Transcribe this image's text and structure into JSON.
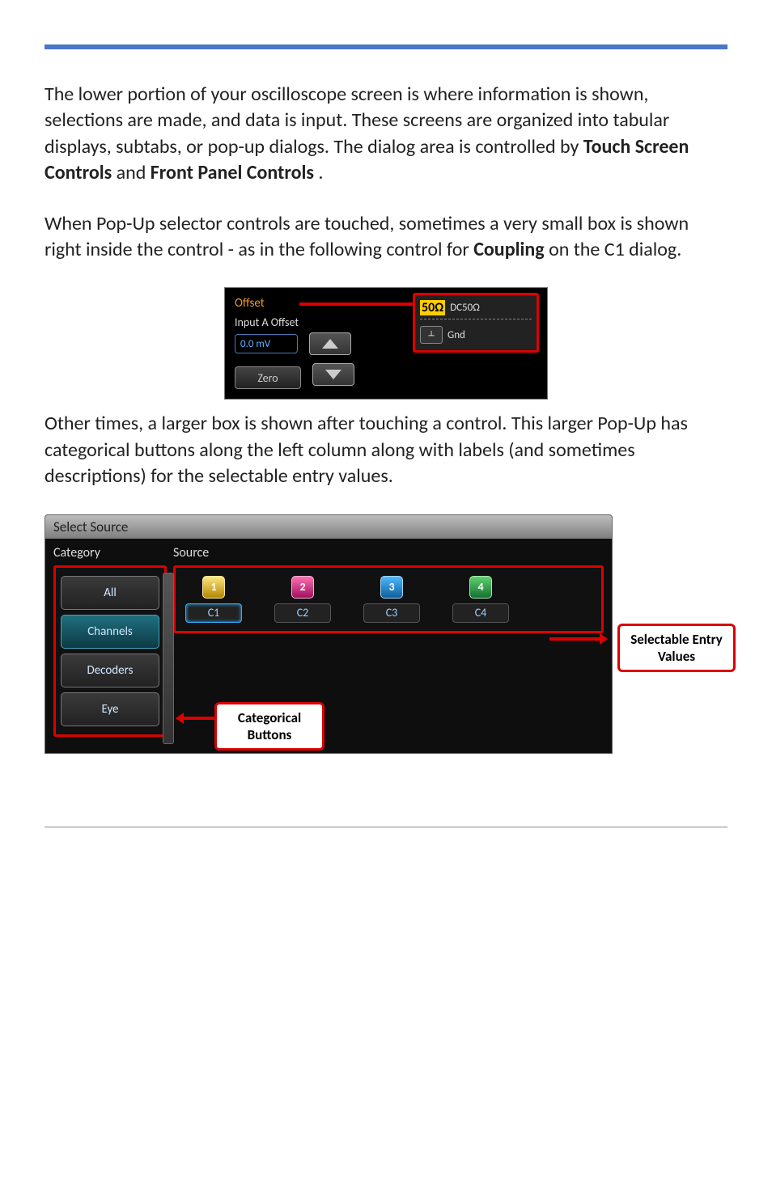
{
  "para1_a": "The lower portion of your oscilloscope screen is where information is shown, selections are made, and data is input. These screens are organized into tabular displays, subtabs, or pop-up dialogs. The dialog area is controlled by ",
  "para1_b": "Touch Screen Controls",
  "para1_c": " and ",
  "para1_d": "Front Panel Controls",
  "para1_e": ".",
  "para2_a": "When Pop-Up selector controls are touched, sometimes a very small box is shown right inside the control - as in the following control for ",
  "para2_b": "Coupling",
  "para2_c": " on the C1 dialog.",
  "shot1": {
    "offset_label": "Offset",
    "input_offset_label": "Input A Offset",
    "offset_value": "0.0 mV",
    "zero_label": "Zero",
    "opt1_badge": "50Ω",
    "opt1_text": "DC50Ω",
    "opt2_text": "Gnd"
  },
  "para3": "Other times, a larger box is shown after touching a control. This larger Pop-Up has categorical buttons along the left column along with labels (and sometimes descriptions) for the selectable entry values.",
  "shot2": {
    "title": "Select Source",
    "category_header": "Category",
    "source_header": "Source",
    "cats": [
      "All",
      "Channels",
      "Decoders",
      "Eye"
    ],
    "channels": [
      {
        "num": "1",
        "label": "C1"
      },
      {
        "num": "2",
        "label": "C2"
      },
      {
        "num": "3",
        "label": "C3"
      },
      {
        "num": "4",
        "label": "C4"
      }
    ],
    "callout_sel": "Selectable\nEntry Values",
    "callout_cat": "Categorical\nButtons"
  }
}
